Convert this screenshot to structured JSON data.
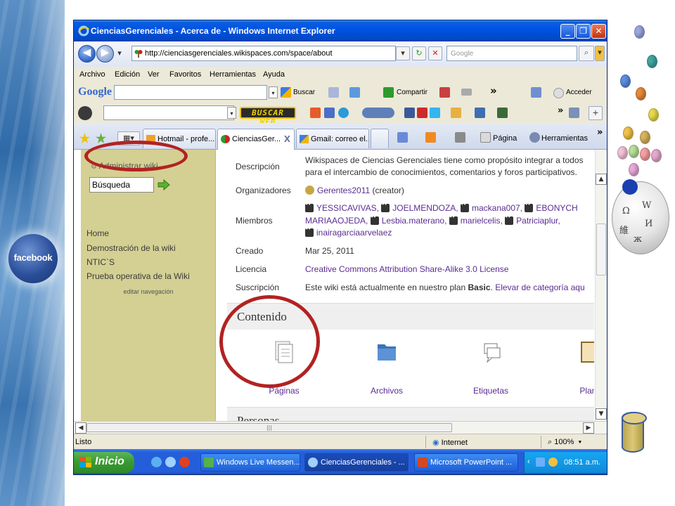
{
  "window": {
    "title": "CienciasGerenciales - Acerca de - Windows Internet Explorer",
    "minimize_glyph": "_",
    "restore_glyph": "❐",
    "close_glyph": "✕"
  },
  "address": {
    "url": "http://cienciasgerenciales.wikispaces.com/space/about",
    "search_placeholder": "Google"
  },
  "menu": [
    "Archivo",
    "Edición",
    "Ver",
    "Favoritos",
    "Herramientas",
    "Ayuda"
  ],
  "google_toolbar": {
    "logo": "Google",
    "buscar": "Buscar",
    "compartir": "Compartir",
    "acceder": "Acceder",
    "more": "»"
  },
  "buscar_toolbar": {
    "button": "BUSCAR WEB"
  },
  "tabs": [
    {
      "label": "Hotmail - profe...",
      "active": false
    },
    {
      "label": "CienciasGer...",
      "active": true
    },
    {
      "label": "Gmail: correo el...",
      "active": false
    }
  ],
  "tab_close": "X",
  "commands": {
    "pagina": "Página",
    "herramientas": "Herramientas"
  },
  "sidebar": {
    "admin_link": "Administrar wiki",
    "search_value": "Búsqueda",
    "nav": [
      "Home",
      "Demostración de la wiki",
      "NTIC`S",
      "Prueba operativa de la Wiki"
    ],
    "edit_nav": "editar navegación"
  },
  "about": {
    "descripcion_label": "Descripción",
    "descripcion_line1": "Wikispaces de Ciencias Gerenciales tiene como propósito integrar a todos",
    "descripcion_line2": "para el intercambio de conocimientos, comentarios y foros participativos.",
    "organizadores_label": "Organizadores",
    "organizer": "Gerentes2011",
    "organizer_role": "(creator)",
    "miembros_label": "Miembros",
    "members_line1": [
      "YESSICAVIVAS,",
      "JOELMENDOZA,",
      "mackana007,",
      "EBONYCH"
    ],
    "members_line2": [
      "MARIAAOJEDA,",
      "Lesbia.materano,",
      "marielcelis,",
      "Patriciaplur,"
    ],
    "members_line3": [
      "inairagarciaarvelaez"
    ],
    "creado_label": "Creado",
    "creado_value": "Mar 25, 2011",
    "licencia_label": "Licencia",
    "licencia_value": "Creative Commons Attribution Share-Alike 3.0 License",
    "suscripcion_label": "Suscripción",
    "suscripcion_text": "Este wiki está actualmente en nuestro plan",
    "suscripcion_plan": "Basic",
    "suscripcion_sep": ".",
    "suscripcion_link": "Elevar de categoría aqu"
  },
  "contenido": {
    "title": "Contenido",
    "items": [
      "Páginas",
      "Archivos",
      "Etiquetas",
      "Plant"
    ]
  },
  "personas": {
    "title": "Personas"
  },
  "status": {
    "text": "Listo",
    "zone": "Internet",
    "zoom": "100%"
  },
  "taskbar": {
    "start": "Inicio",
    "items": [
      "Windows Live Messen...",
      "CienciasGerenciales - ...",
      "Microsoft PowerPoint ..."
    ],
    "clock": "08:51 a.m."
  },
  "slide": {
    "facebook": "facebook"
  },
  "colors": {
    "wiki_sidebar": "#d4d093",
    "link_purple": "#5a2d91",
    "highlight_red": "#b22222",
    "xp_blue": "#245edb",
    "start_green": "#3c9a34"
  }
}
